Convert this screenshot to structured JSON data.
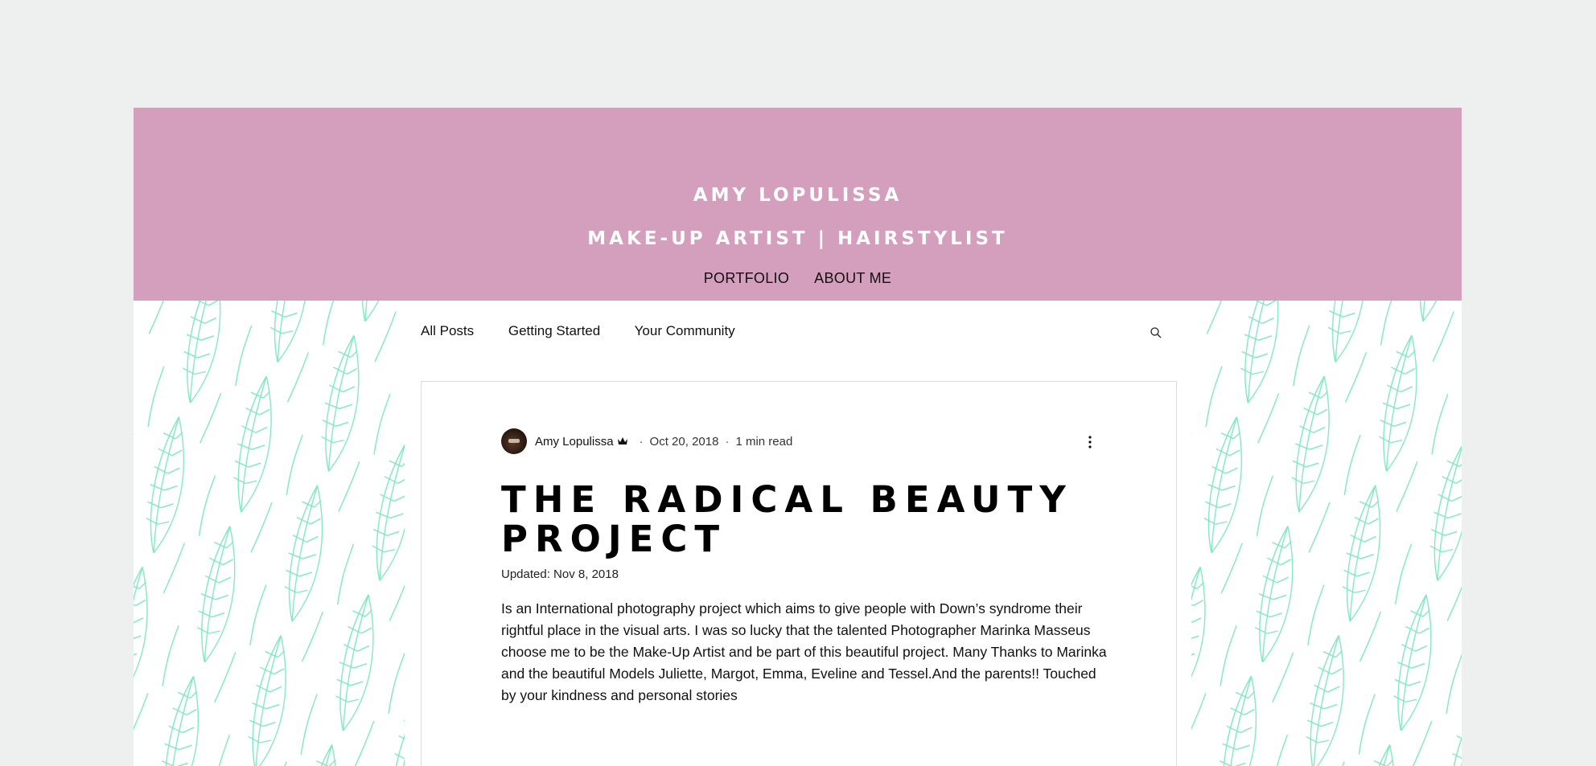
{
  "header": {
    "title": "AMY LOPULISSA",
    "subtitle": "MAKE-UP ARTIST | HAIRSTYLIST",
    "nav": [
      "PORTFOLIO",
      "ABOUT ME"
    ]
  },
  "blog_nav": {
    "items": [
      "All Posts",
      "Getting Started",
      "Your Community"
    ],
    "search_icon": "search-icon"
  },
  "post": {
    "author": "Amy Lopulissa",
    "author_badge_icon": "crown-icon",
    "separator": "·",
    "date": "Oct 20, 2018",
    "read_time": "1 min read",
    "more_icon": "more-vertical-icon",
    "title": "THE RADICAL BEAUTY PROJECT",
    "updated": "Updated: Nov 8, 2018",
    "body": "Is an International photography project which aims to give people with Down’s syndrome their rightful place in the visual arts. I was so lucky that the talented Photographer Marinka Masseus choose me to be the Make-Up Artist and be part of this beautiful  project. Many Thanks to Marinka and the beautiful Models Juliette, Margot, Emma, Eveline and Tessel.And the parents!! Touched by your kindness and personal stories"
  },
  "colors": {
    "page_bg": "#eef0ef",
    "header_bg": "#d39fbc",
    "leaf_pattern": "#7fe8c0"
  }
}
